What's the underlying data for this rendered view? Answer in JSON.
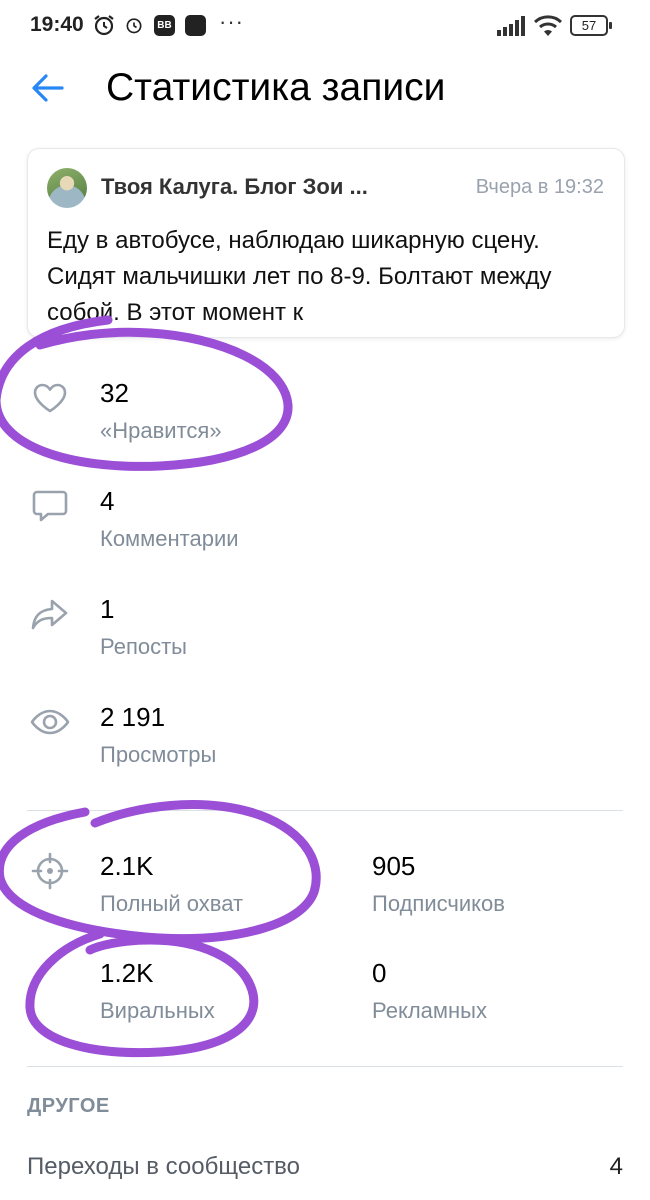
{
  "status_bar": {
    "time": "19:40",
    "vk_badge": "BB",
    "dots": "···",
    "battery": "57"
  },
  "header": {
    "title": "Статистика записи"
  },
  "post": {
    "author": "Твоя Калуга. Блог Зои ...",
    "time": "Вчера в 19:32",
    "text": "Еду в автобусе, наблюдаю шикарную сцену. Сидят мальчишки лет по 8-9. Болтают между собой. В этот момент к"
  },
  "stats": {
    "likes": {
      "value": "32",
      "label": "«Нравится»"
    },
    "comments": {
      "value": "4",
      "label": "Комментарии"
    },
    "reposts": {
      "value": "1",
      "label": "Репосты"
    },
    "views": {
      "value": "2 191",
      "label": "Просмотры"
    }
  },
  "reach": {
    "total": {
      "value": "2.1K",
      "label": "Полный охват"
    },
    "subscribers": {
      "value": "905",
      "label": "Подписчиков"
    },
    "viral": {
      "value": "1.2K",
      "label": "Виральных"
    },
    "ads": {
      "value": "0",
      "label": "Рекламных"
    }
  },
  "other": {
    "section_title": "ДРУГОЕ",
    "community_transitions": {
      "label": "Переходы в сообщество",
      "value": "4"
    }
  },
  "icons": {
    "back": "arrow-left-icon",
    "like": "heart-icon",
    "comment": "comment-icon",
    "repost": "share-icon",
    "views": "eye-icon",
    "reach": "target-icon"
  },
  "colors": {
    "accent": "#2787f5",
    "annotation": "#9b4fd6",
    "secondary_text": "#818c99"
  }
}
